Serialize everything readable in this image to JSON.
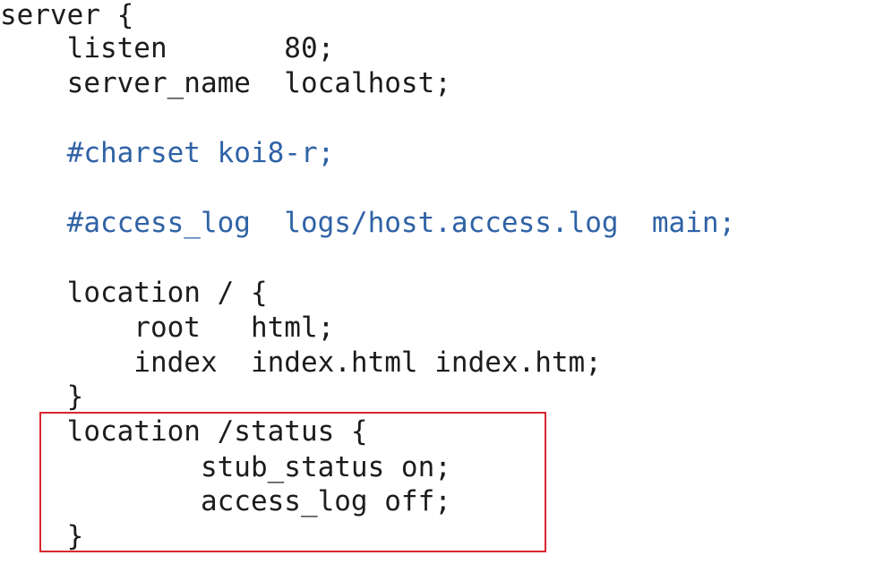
{
  "code": {
    "lines": [
      {
        "text": "server {",
        "kind": "code"
      },
      {
        "text": "    listen       80;",
        "kind": "code"
      },
      {
        "text": "    server_name  localhost;",
        "kind": "code"
      },
      {
        "text": "",
        "kind": "blank"
      },
      {
        "text": "    #charset koi8-r;",
        "kind": "comment"
      },
      {
        "text": "",
        "kind": "blank"
      },
      {
        "text": "    #access_log  logs/host.access.log  main;",
        "kind": "comment"
      },
      {
        "text": "",
        "kind": "blank"
      },
      {
        "text": "    location / {",
        "kind": "code"
      },
      {
        "text": "        root   html;",
        "kind": "code"
      },
      {
        "text": "        index  index.html index.htm;",
        "kind": "code"
      },
      {
        "text": "    }",
        "kind": "code"
      },
      {
        "text": "    location /status {",
        "kind": "code"
      },
      {
        "text": "            stub_status on;",
        "kind": "code"
      },
      {
        "text": "            access_log off;",
        "kind": "code"
      },
      {
        "text": "    }",
        "kind": "code"
      }
    ]
  },
  "colors": {
    "text": "#1c1c1c",
    "comment": "#2f62a6",
    "highlight_border": "#d8262f",
    "background": "#ffffff"
  }
}
